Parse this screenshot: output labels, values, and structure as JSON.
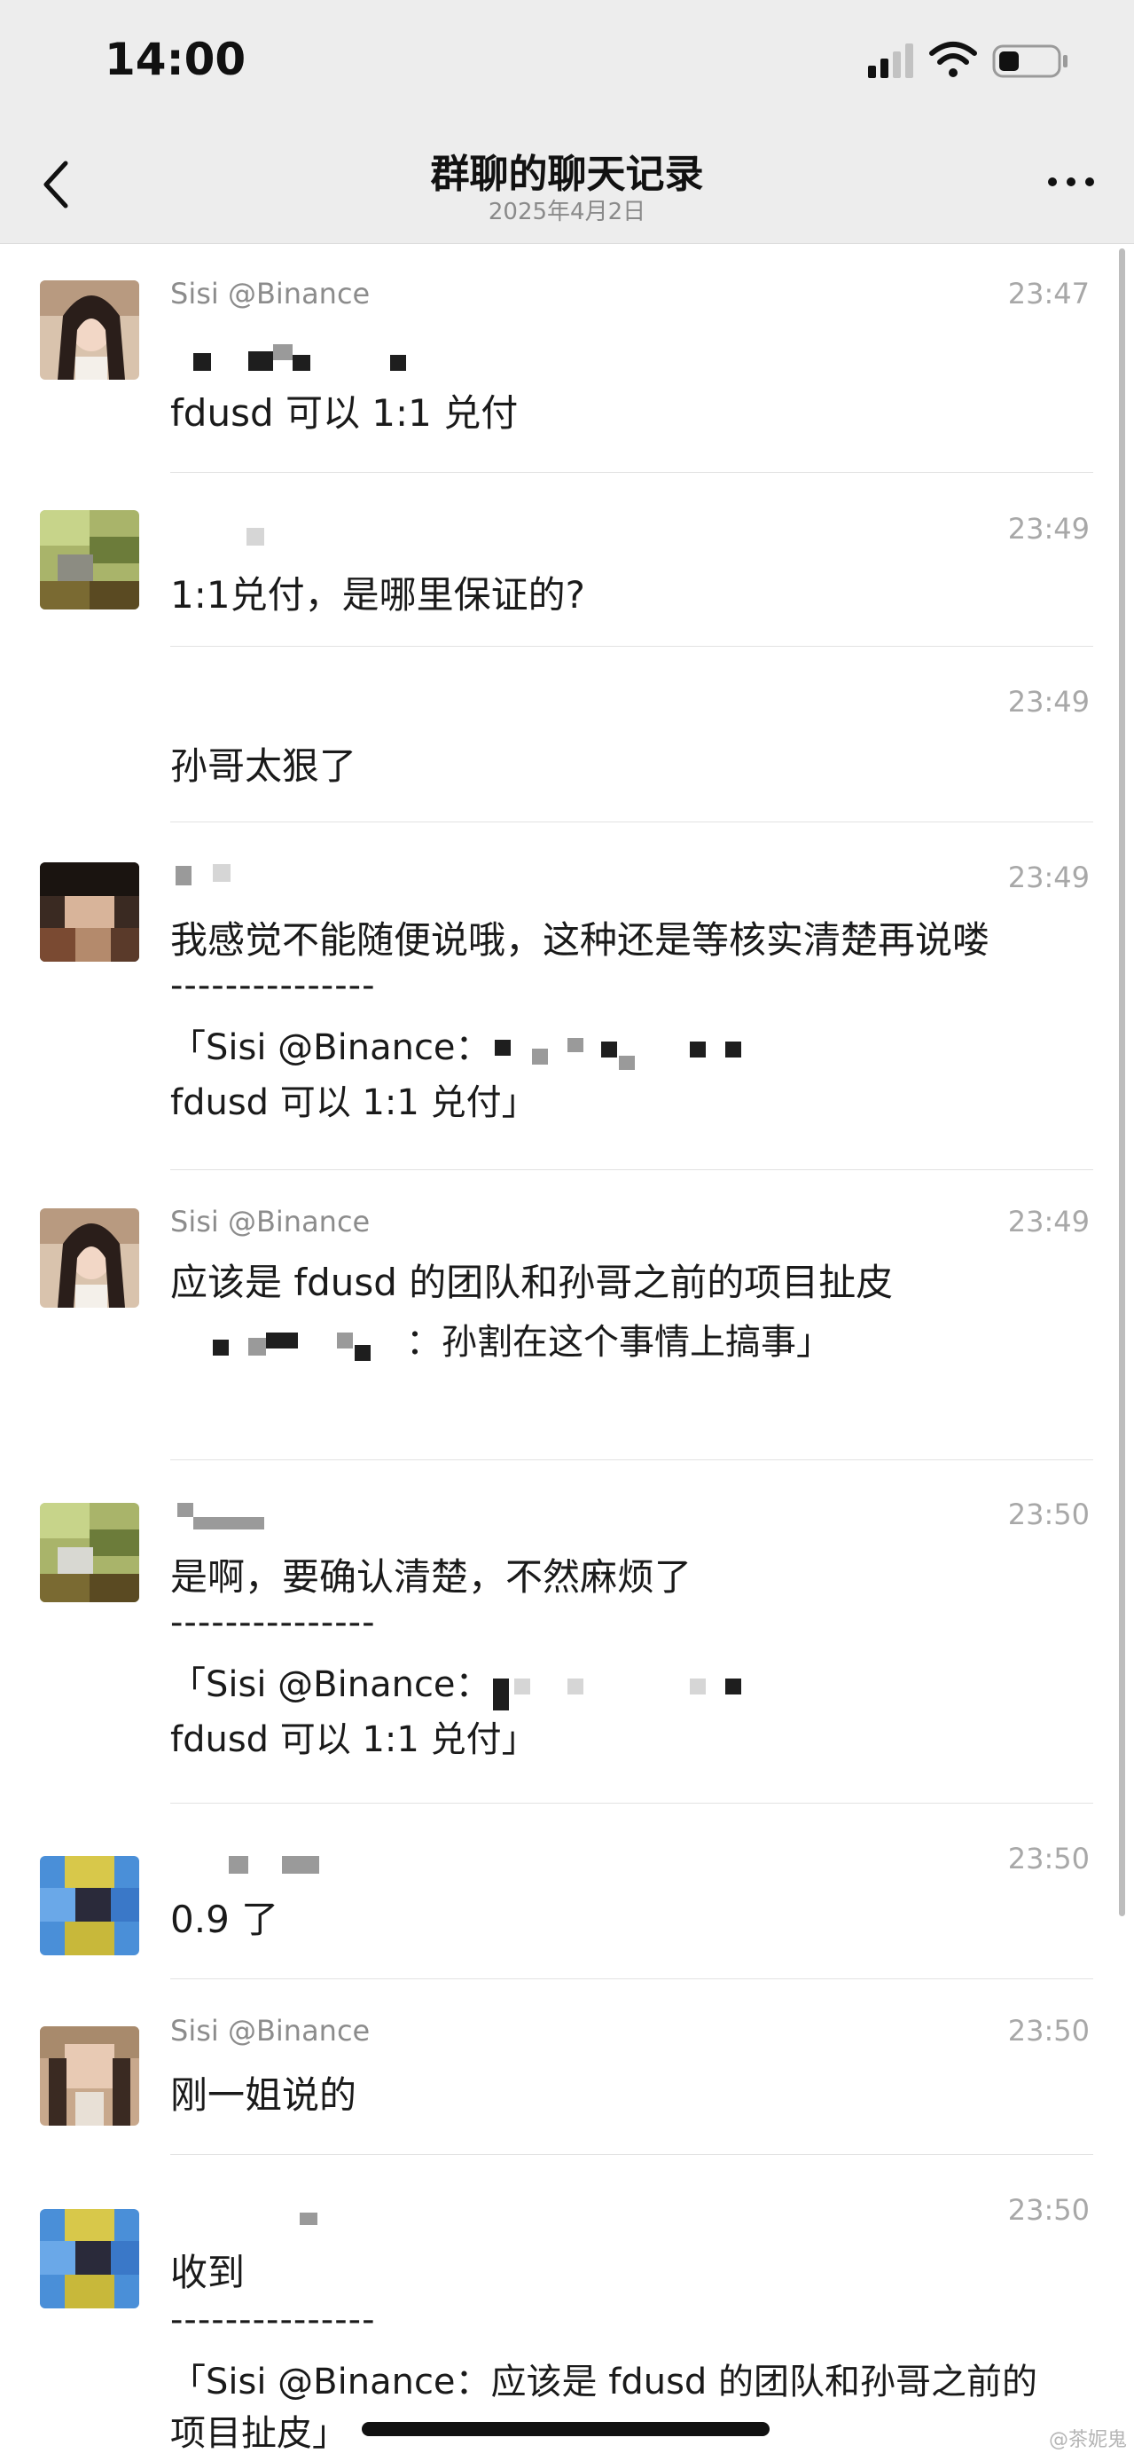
{
  "status_bar": {
    "time": "14:00",
    "icons": [
      "signal-icon",
      "wifi-icon",
      "battery-icon"
    ]
  },
  "nav": {
    "title": "群聊的聊天记录",
    "subtitle": "2025年4月2日",
    "icons": [
      "back-icon",
      "more-icon"
    ]
  },
  "messages": [
    {
      "sender": "Sisi @Binance",
      "time": "23:47",
      "text": "fdusd 可以 1:1 兑付"
    },
    {
      "sender": "",
      "time": "23:49",
      "text": "1:1兑付，是哪里保证的?"
    },
    {
      "sender": "",
      "time": "23:49",
      "text": "孙哥太狠了"
    },
    {
      "sender": "",
      "time": "23:49",
      "text": "我感觉不能随便说哦，这种还是等核实清楚再说喽",
      "divider": "---------------",
      "quote_line1": "「Sisi @Binance：",
      "quote_line2": "fdusd 可以 1:1 兑付」"
    },
    {
      "sender": "Sisi @Binance",
      "time": "23:49",
      "text": "应该是 fdusd 的团队和孙哥之前的项目扯皮",
      "quote_line2": "：孙割在这个事情上搞事」"
    },
    {
      "sender": "",
      "time": "23:50",
      "text": "是啊，要确认清楚，不然麻烦了",
      "divider": "---------------",
      "quote_line1": "「Sisi @Binance：",
      "quote_line2": "fdusd 可以 1:1 兑付」"
    },
    {
      "sender": "",
      "time": "23:50",
      "text": "0.9 了"
    },
    {
      "sender": "Sisi @Binance",
      "time": "23:50",
      "text": "刚一姐说的"
    },
    {
      "sender": "",
      "time": "23:50",
      "text": "收到",
      "divider": "---------------",
      "quote_line1": "「Sisi @Binance：应该是 fdusd 的团队和孙哥之前的",
      "quote_line2": "项目扯皮」"
    }
  ],
  "watermark": "@茶妮鬼"
}
